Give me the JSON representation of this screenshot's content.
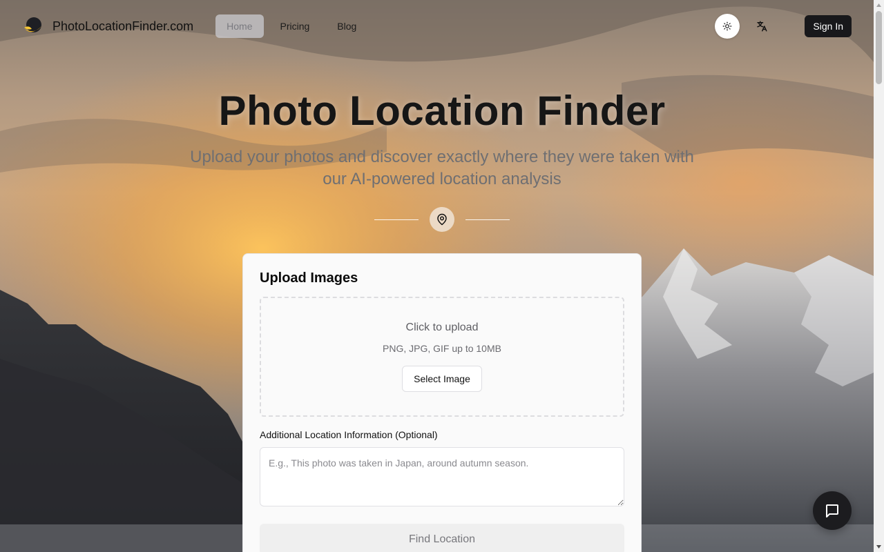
{
  "header": {
    "brand_name": "PhotoLocationFinder.com",
    "nav": [
      {
        "label": "Home",
        "active": true
      },
      {
        "label": "Pricing",
        "active": false
      },
      {
        "label": "Blog",
        "active": false
      }
    ],
    "theme_icon": "sun-icon",
    "language_icon": "translate-icon",
    "signin_label": "Sign In"
  },
  "hero": {
    "title": "Photo Location Finder",
    "subtitle": "Upload your photos and discover exactly where they were taken with our AI-powered location analysis",
    "divider_icon": "map-pin-icon"
  },
  "upload_card": {
    "title": "Upload Images",
    "dropzone_title": "Click to upload",
    "dropzone_hint": "PNG, JPG, GIF up to 10MB",
    "select_button": "Select Image",
    "info_label": "Additional Location Information (Optional)",
    "info_placeholder": "E.g., This photo was taken in Japan, around autumn season.",
    "info_value": "",
    "submit_button": "Find Location"
  },
  "chat": {
    "icon": "chat-bubble-icon"
  },
  "colors": {
    "primary_button": "#18181b",
    "active_nav_bg": "#c8c8cd",
    "card_bg": "#fafafa"
  }
}
